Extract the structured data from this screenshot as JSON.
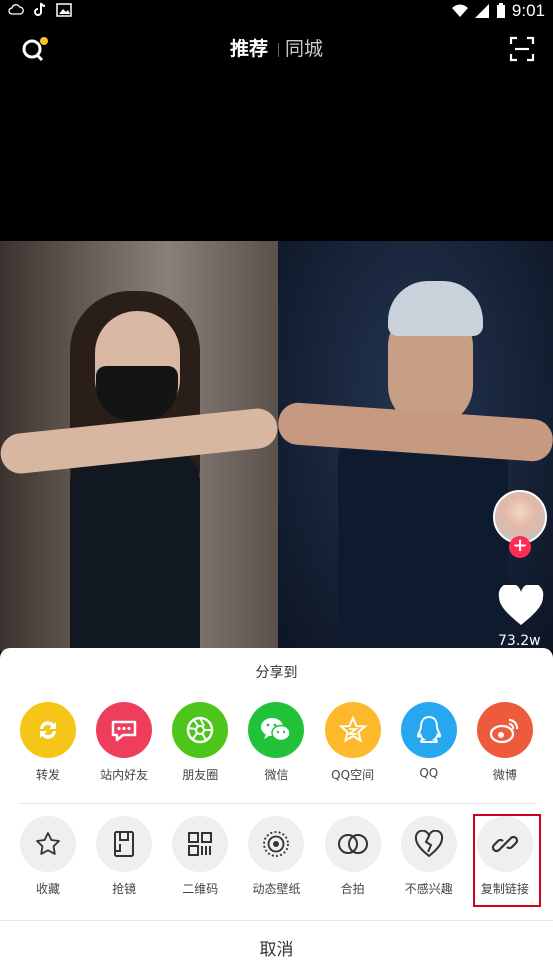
{
  "status_bar": {
    "time": "9:01"
  },
  "nav": {
    "tab_recommend": "推荐",
    "tab_local": "同城"
  },
  "video": {
    "like_count": "73.2w"
  },
  "share_sheet": {
    "title": "分享到",
    "row1": [
      {
        "label": "转发",
        "icon": "repost-icon",
        "color": "#f5c518"
      },
      {
        "label": "站内好友",
        "icon": "chat-icon",
        "color": "#ef3e5c"
      },
      {
        "label": "朋友圈",
        "icon": "moments-icon",
        "color": "#4cc61a"
      },
      {
        "label": "微信",
        "icon": "wechat-icon",
        "color": "#21c23a"
      },
      {
        "label": "QQ空间",
        "icon": "qzone-icon",
        "color": "#fdb92b"
      },
      {
        "label": "QQ",
        "icon": "qq-icon",
        "color": "#27a7ef"
      },
      {
        "label": "微博",
        "icon": "weibo-icon",
        "color": "#ee5a3c"
      }
    ],
    "row2": [
      {
        "label": "收藏",
        "icon": "star-icon"
      },
      {
        "label": "抢镜",
        "icon": "duet-icon"
      },
      {
        "label": "二维码",
        "icon": "qrcode-icon"
      },
      {
        "label": "动态壁纸",
        "icon": "live-wallpaper-icon"
      },
      {
        "label": "合拍",
        "icon": "collab-icon"
      },
      {
        "label": "不感兴趣",
        "icon": "broken-heart-icon"
      },
      {
        "label": "复制链接",
        "icon": "link-icon"
      }
    ],
    "cancel": "取消"
  }
}
